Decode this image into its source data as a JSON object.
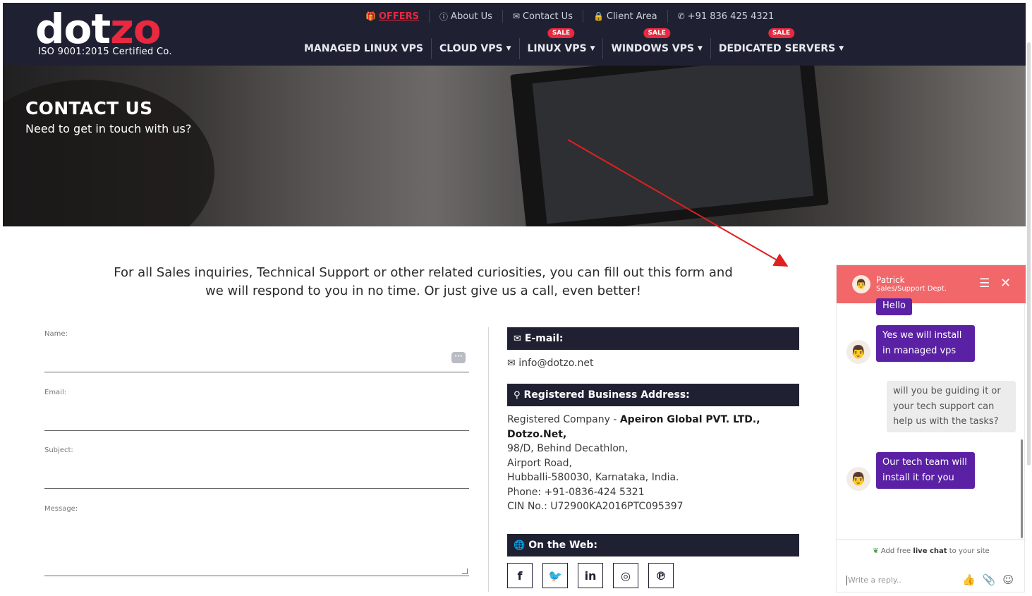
{
  "brand": {
    "logo_part1": "dot",
    "logo_part2": "zo",
    "tagline": "ISO 9001:2015 Certified Co."
  },
  "topbar": {
    "offers": "OFFERS",
    "about": "About Us",
    "contact": "Contact Us",
    "client": "Client Area",
    "phone": "+91 836 425 4321"
  },
  "nav": {
    "sale_badge": "SALE",
    "items": [
      {
        "label": "MANAGED LINUX VPS"
      },
      {
        "label": "CLOUD VPS"
      },
      {
        "label": "LINUX VPS"
      },
      {
        "label": "WINDOWS VPS"
      },
      {
        "label": "DEDICATED SERVERS"
      }
    ]
  },
  "hero": {
    "title": "CONTACT US",
    "subtitle": "Need to get in touch with us?"
  },
  "intro": "For all Sales inquiries, Technical Support or other related curiosities, you can fill out this form and we will respond to you in no time. Or just give us a call, even better!",
  "form": {
    "name_label": "Name:",
    "email_label": "Email:",
    "subject_label": "Subject:",
    "message_label": "Message:"
  },
  "info": {
    "email_head": "E-mail:",
    "email_value": "info@dotzo.net",
    "address_head": "Registered Business Address:",
    "reg_company_label": "Registered Company - ",
    "company_name": "Apeiron Global PVT. LTD.,",
    "dotzo": "Dotzo.Net,",
    "addr1": "98/D, Behind Decathlon,",
    "addr2": "Airport Road,",
    "addr3": "Hubballi-580030, Karnataka, India.",
    "phone": "Phone: +91-0836-424 5321",
    "cin": "CIN No.: U72900KA2016PTC095397",
    "web_head": "On the Web:"
  },
  "social": [
    {
      "icon": "facebook-icon",
      "glyph": "f"
    },
    {
      "icon": "twitter-icon",
      "glyph": "🐦"
    },
    {
      "icon": "linkedin-icon",
      "glyph": "in"
    },
    {
      "icon": "instagram-icon",
      "glyph": "◎"
    },
    {
      "icon": "pinterest-icon",
      "glyph": "℗"
    }
  ],
  "chat": {
    "agent_name": "Patrick",
    "agent_dept": "Sales/Support Dept.",
    "messages": [
      {
        "from": "agent",
        "text": "Hello"
      },
      {
        "from": "agent",
        "text": "Yes we will install in managed vps"
      },
      {
        "from": "user",
        "text": "will you be guiding it or your tech support can help us with the tasks?"
      },
      {
        "from": "agent",
        "text": "Our tech team will install it for you"
      }
    ],
    "promo_prefix": "Add free ",
    "promo_bold": "live chat",
    "promo_suffix": " to your site",
    "input_placeholder": "Write a reply.."
  },
  "colors": {
    "navy": "#1f2133",
    "brand_red": "#e8293f",
    "chat_header": "#f1676a",
    "chat_agent_bubble": "#5b21a4",
    "annotation_arrow": "#e02020"
  }
}
